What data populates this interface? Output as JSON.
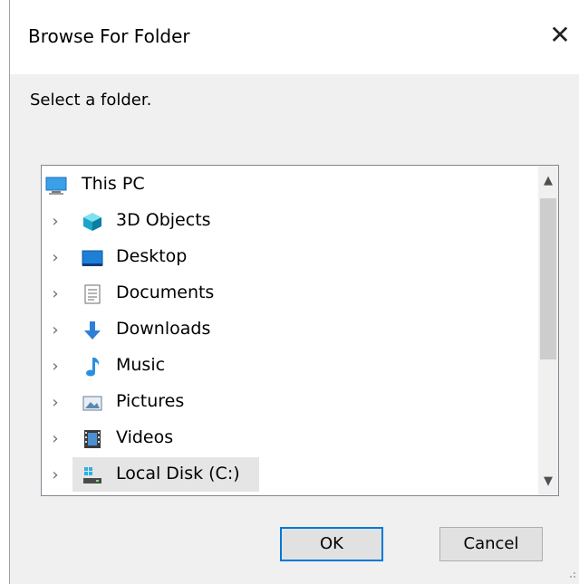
{
  "dialog": {
    "title": "Browse For Folder",
    "prompt": "Select a folder.",
    "ok_label": "OK",
    "cancel_label": "Cancel"
  },
  "tree": {
    "root": {
      "label": "This PC",
      "icon": "pc-icon"
    },
    "items": [
      {
        "label": "3D Objects",
        "icon": "3d-objects-icon"
      },
      {
        "label": "Desktop",
        "icon": "desktop-icon"
      },
      {
        "label": "Documents",
        "icon": "documents-icon"
      },
      {
        "label": "Downloads",
        "icon": "downloads-icon"
      },
      {
        "label": "Music",
        "icon": "music-icon"
      },
      {
        "label": "Pictures",
        "icon": "pictures-icon"
      },
      {
        "label": "Videos",
        "icon": "videos-icon"
      },
      {
        "label": "Local Disk (C:)",
        "icon": "local-disk-icon",
        "selected": true
      }
    ]
  },
  "colors": {
    "accent": "#0078d7",
    "selection": "#e5e5e5",
    "dialog_bg": "#f0f0f0"
  }
}
